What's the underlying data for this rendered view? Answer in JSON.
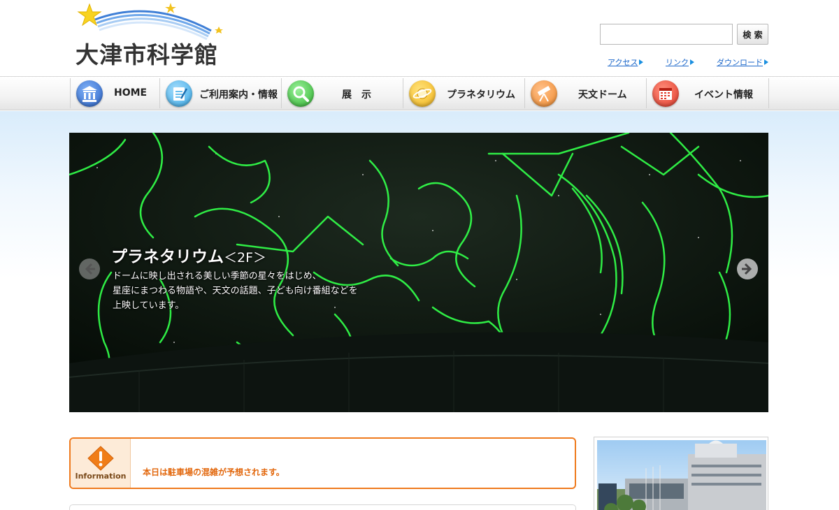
{
  "header": {
    "logo_text": "大津市科学館",
    "search": {
      "value": "",
      "placeholder": "",
      "button_label": "検 索"
    },
    "util_links": [
      "アクセス",
      "リンク",
      "ダウンロード"
    ]
  },
  "nav": {
    "items": [
      {
        "label": "HOME",
        "icon": "museum-icon",
        "color": "#2a63c9"
      },
      {
        "label": "ご利用案内・情報",
        "icon": "notepad-icon",
        "color": "#35a8e8"
      },
      {
        "label": "展　示",
        "icon": "magnifier-icon",
        "color": "#2fb32f"
      },
      {
        "label": "プラネタリウム",
        "icon": "planet-icon",
        "color": "#f2b319"
      },
      {
        "label": "天文ドーム",
        "icon": "telescope-icon",
        "color": "#f08a2c"
      },
      {
        "label": "イベント情報",
        "icon": "calendar-icon",
        "color": "#e23a2a"
      }
    ]
  },
  "hero": {
    "title": "プラネタリウム",
    "title_sub": "＜2F＞",
    "lines": [
      "ドームに映し出される美しい季節の星々をはじめ、",
      "星座にまつわる物語や、天文の話題、子ども向け番組などを",
      "上映しています。"
    ]
  },
  "info": {
    "badge_label": "Information",
    "message": "本日は駐車場の混雑が予想されます。"
  },
  "colors": {
    "accent_orange": "#ef7a1d",
    "link_blue": "#1a66c9",
    "constellation_green": "#32ff4a"
  }
}
